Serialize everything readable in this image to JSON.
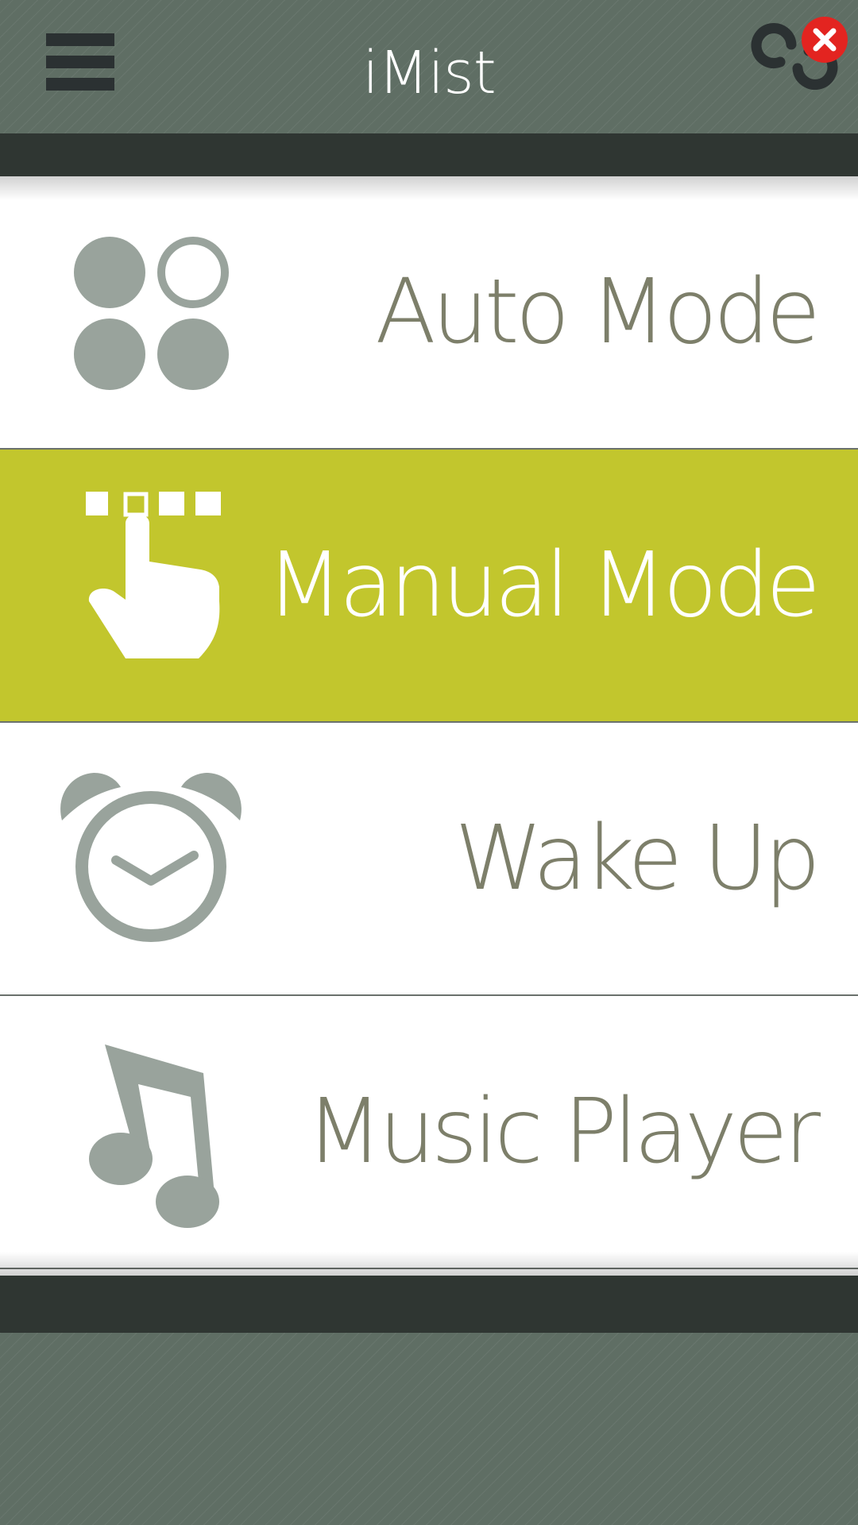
{
  "header": {
    "title": "iMist",
    "menu_icon": "hamburger-menu-icon",
    "connection_icon": "link-icon",
    "connection_status_icon": "close-icon",
    "status_color": "#e32420"
  },
  "menu": {
    "accent_color": "#c2c62d",
    "items": [
      {
        "label": "Auto Mode",
        "icon": "four-dots-icon",
        "selected": false
      },
      {
        "label": "Manual Mode",
        "icon": "tap-finger-icon",
        "selected": true
      },
      {
        "label": "Wake Up",
        "icon": "alarm-clock-icon",
        "selected": false
      },
      {
        "label": "Music Player",
        "icon": "music-note-icon",
        "selected": false
      }
    ]
  }
}
